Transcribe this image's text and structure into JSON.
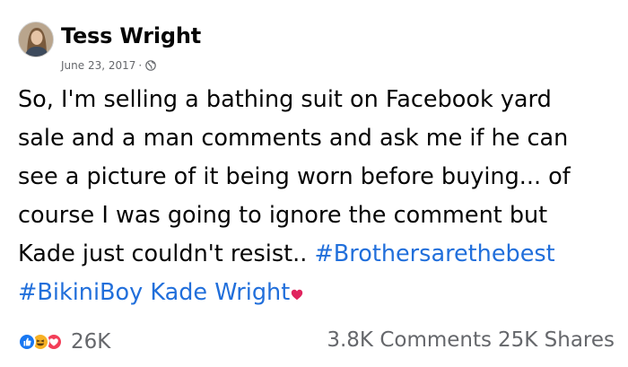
{
  "post": {
    "author": "Tess Wright",
    "date": "June 23, 2017",
    "separator": "·",
    "privacy_icon": "globe-icon",
    "body": {
      "line1": "So, I'm selling a bathing suit on Facebook yard",
      "line2": "sale and a man comments and ask me if he can",
      "line3": "see a picture of it being worn before buying... of",
      "line4": "course I was going to ignore the comment but",
      "line5_text": "Kade just couldn't resist.. ",
      "hashtag1": "#Brothersarethebest",
      "hashtag2": "#BikiniBoy",
      "mention": "Kade Wright",
      "trailing_icon": "heart-icon"
    }
  },
  "footer": {
    "reaction_icons": [
      "like-icon",
      "haha-icon",
      "love-icon"
    ],
    "reaction_count": "26K",
    "comments": "3.8K Comments",
    "shares": "25K Shares"
  },
  "colors": {
    "hashtag": "#216fdb",
    "secondary_text": "#65676b",
    "like": "#1877f2",
    "haha": "#f7b125",
    "love": "#f33e58"
  }
}
